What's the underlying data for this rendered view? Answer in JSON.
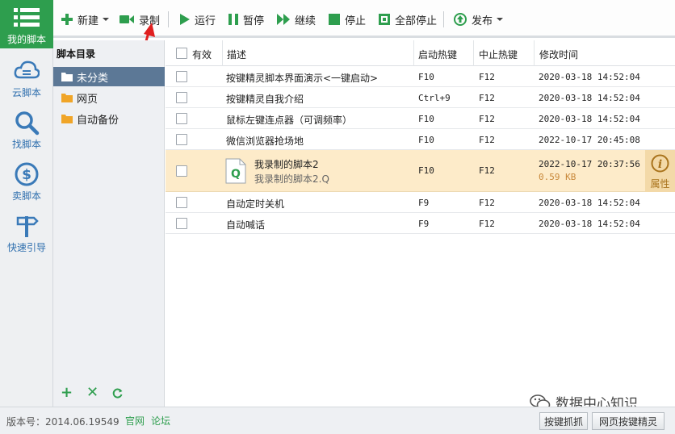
{
  "nav": {
    "my_scripts": "我的脚本",
    "cloud": "云脚本",
    "find": "找脚本",
    "sell": "卖脚本",
    "guide": "快速引导"
  },
  "toolbar": {
    "new": "新建",
    "record": "录制",
    "run": "运行",
    "pause": "暂停",
    "resume": "继续",
    "stop": "停止",
    "stop_all": "全部停止",
    "publish": "发布"
  },
  "directory": {
    "title": "脚本目录",
    "items": [
      "未分类",
      "网页",
      "自动备份"
    ]
  },
  "table": {
    "headers": {
      "valid": "有效",
      "desc": "描述",
      "start_hotkey": "启动热键",
      "stop_hotkey": "中止热键",
      "modified": "修改时间"
    },
    "rows": [
      {
        "desc": "按键精灵脚本界面演示<一键启动>",
        "start": "F10",
        "stop": "F12",
        "time": "2020-03-18 14:52:04"
      },
      {
        "desc": "按键精灵自我介绍",
        "start": "Ctrl+9",
        "stop": "F12",
        "time": "2020-03-18 14:52:04"
      },
      {
        "desc": "鼠标左键连点器（可调频率）",
        "start": "F10",
        "stop": "F12",
        "time": "2020-03-18 14:52:04"
      },
      {
        "desc": "微信浏览器抢场地",
        "start": "F10",
        "stop": "F12",
        "time": "2022-10-17 20:45:08"
      }
    ],
    "highlight": {
      "name": "我录制的脚本2",
      "file": "我录制的脚本2.Q",
      "start": "F10",
      "stop": "F12",
      "time": "2022-10-17 20:37:56",
      "size": "0.59 KB",
      "attr_label": "属性"
    },
    "rows_after": [
      {
        "desc": "自动定时关机",
        "start": "F9",
        "stop": "F12",
        "time": "2020-03-18 14:52:04"
      },
      {
        "desc": "自动喊话",
        "start": "F9",
        "stop": "F12",
        "time": "2020-03-18 14:52:04"
      }
    ]
  },
  "status": {
    "version": "版本号：2014.06.19549",
    "official": "官网",
    "forum": "论坛",
    "btn_capture": "按键抓抓",
    "btn_web": "网页按键精灵",
    "watermark": "数据中心知识"
  },
  "colors": {
    "accent_green": "#2e9e4e",
    "selected_dir": "#5c7896",
    "highlight_row": "#fdebc9"
  }
}
